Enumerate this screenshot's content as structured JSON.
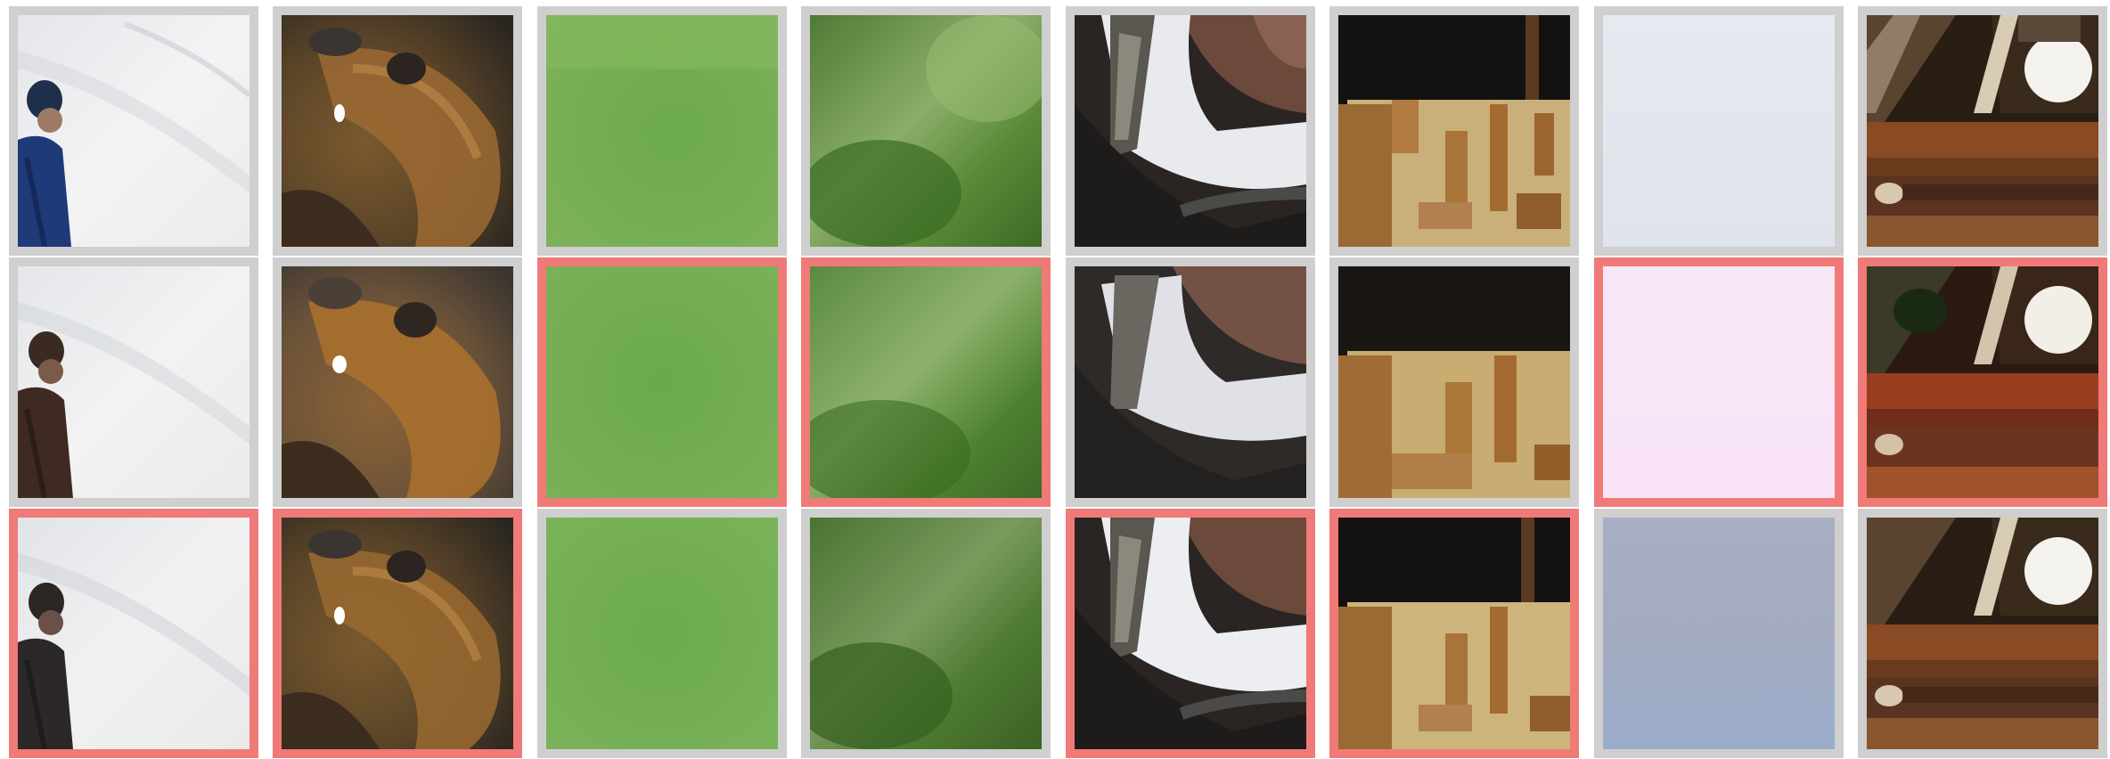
{
  "title": "",
  "colors": {
    "frame_default": "#cfcfcf",
    "frame_highlight": "#f07a78",
    "background": "#ffffff"
  },
  "rows": [
    {
      "tiles": [
        {
          "subject": "person-in-snow",
          "tone": "blue-coat",
          "highlight": false
        },
        {
          "subject": "animal-fur-closeup",
          "tone": "brown-fur",
          "highlight": false
        },
        {
          "subject": "green-blur",
          "tone": "light-green",
          "highlight": false
        },
        {
          "subject": "green-blur",
          "tone": "dark-green",
          "highlight": false
        },
        {
          "subject": "clothing-strap-closeup",
          "tone": "white-shirt",
          "highlight": false
        },
        {
          "subject": "rusty-wood-panel",
          "tone": "tan-rust",
          "highlight": false
        },
        {
          "subject": "pale-sky",
          "tone": "pale-blue-grey",
          "highlight": false
        },
        {
          "subject": "ornate-wood-frame",
          "tone": "brown-wood",
          "highlight": false
        }
      ]
    },
    {
      "tiles": [
        {
          "subject": "person-in-snow",
          "tone": "brown-coat",
          "highlight": false
        },
        {
          "subject": "animal-fur-closeup",
          "tone": "blurred-brown",
          "highlight": false
        },
        {
          "subject": "green-blur",
          "tone": "light-green",
          "highlight": true
        },
        {
          "subject": "green-blur",
          "tone": "mid-green",
          "highlight": true
        },
        {
          "subject": "clothing-strap-closeup",
          "tone": "blurred-white",
          "highlight": false
        },
        {
          "subject": "rusty-wood-panel",
          "tone": "blurred-tan",
          "highlight": false
        },
        {
          "subject": "pale-sky",
          "tone": "pale-pink",
          "highlight": true
        },
        {
          "subject": "ornate-wood-frame",
          "tone": "red-wood",
          "highlight": true
        }
      ]
    },
    {
      "tiles": [
        {
          "subject": "person-in-snow",
          "tone": "dark-coat",
          "highlight": true
        },
        {
          "subject": "animal-fur-closeup",
          "tone": "sharp-brown",
          "highlight": true
        },
        {
          "subject": "green-blur",
          "tone": "light-green",
          "highlight": false
        },
        {
          "subject": "green-blur",
          "tone": "dark-green",
          "highlight": false
        },
        {
          "subject": "clothing-strap-closeup",
          "tone": "white-shirt",
          "highlight": true
        },
        {
          "subject": "rusty-wood-panel",
          "tone": "tan-rust",
          "highlight": true
        },
        {
          "subject": "pale-sky",
          "tone": "blue-grey",
          "highlight": false
        },
        {
          "subject": "ornate-wood-frame",
          "tone": "brown-wood",
          "highlight": false
        }
      ]
    }
  ]
}
